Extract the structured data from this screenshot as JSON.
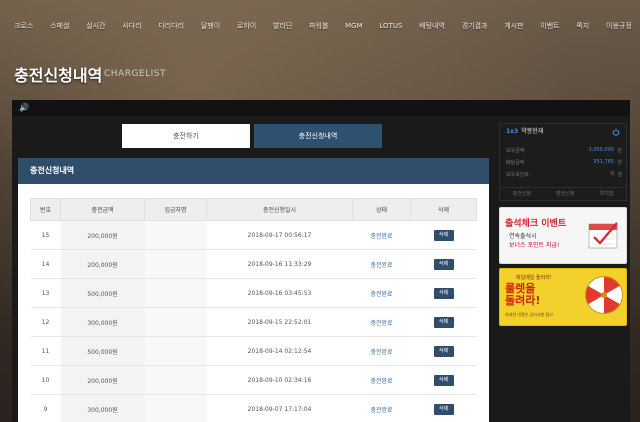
{
  "nav": {
    "items": [
      "크로스",
      "스페셜",
      "실시간",
      "사다리",
      "다리다리",
      "달팽이",
      "로하이",
      "발라딘",
      "파워볼",
      "MGM",
      "LOTUS",
      "배팅내역",
      "경기결과",
      "게시판",
      "이벤트",
      "쪽지",
      "이용규정"
    ]
  },
  "page": {
    "title": "충전신청내역",
    "subtitle": "CHARGELIST"
  },
  "tabs": {
    "charge": "충전하기",
    "history": "충전신청내역"
  },
  "panel": {
    "title": "충전신청내역"
  },
  "table": {
    "headers": [
      "번호",
      "충전금액",
      "입금자명",
      "충전신청일시",
      "상태",
      "삭제"
    ],
    "rows": [
      {
        "no": "15",
        "amount": "200,000원",
        "depositor": "",
        "datetime": "2018-09-17 00:56:17",
        "status": "충전완료",
        "delete": "삭제"
      },
      {
        "no": "14",
        "amount": "200,000원",
        "depositor": "",
        "datetime": "2018-09-16 11:33:29",
        "status": "충전완료",
        "delete": "삭제"
      },
      {
        "no": "13",
        "amount": "500,000원",
        "depositor": "",
        "datetime": "2018-09-16 03:45:53",
        "status": "충전완료",
        "delete": "삭제"
      },
      {
        "no": "12",
        "amount": "300,000원",
        "depositor": "",
        "datetime": "2018-09-15 22:52:01",
        "status": "충전완료",
        "delete": "삭제"
      },
      {
        "no": "11",
        "amount": "500,000원",
        "depositor": "",
        "datetime": "2018-09-14 02:12:54",
        "status": "충전완료",
        "delete": "삭제"
      },
      {
        "no": "10",
        "amount": "200,000원",
        "depositor": "",
        "datetime": "2018-09-10 02:34:16",
        "status": "충전완료",
        "delete": "삭제"
      },
      {
        "no": "9",
        "amount": "300,000원",
        "depositor": "",
        "datetime": "2018-09-07 17:17:04",
        "status": "충전완료",
        "delete": "삭제"
      }
    ]
  },
  "bet_panel": {
    "badge": "1x3",
    "title": "약봉현재",
    "rows": [
      {
        "label": "보유금액",
        "value": "3,000,000",
        "unit": "원"
      },
      {
        "label": "배팅금액",
        "value": "351,765",
        "unit": "원"
      },
      {
        "label": "보유포인트",
        "value": "0",
        "unit": "점"
      }
    ],
    "links": [
      "충전신청",
      "환전신청",
      "쪽지함"
    ]
  },
  "banners": {
    "checkin": {
      "title": "출석체크 이벤트",
      "line1": "연속출석시",
      "line2": "보너스 포인트 지급!"
    },
    "roulette": {
      "top": "매일매일 돌려라!",
      "main_line1": "룰렛을",
      "main_line2": "돌려라!",
      "bottom": "자세한 내용은 공지사항 참고"
    }
  },
  "colors": {
    "accent": "#2f4e6b",
    "status": "#3a6ea5",
    "badge": "#4b8ed3"
  }
}
